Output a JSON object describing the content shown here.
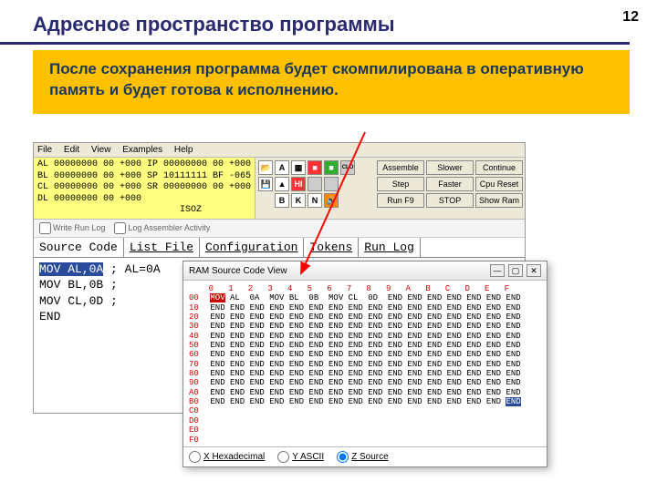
{
  "slide": {
    "title": "Адресное пространство программы",
    "number": "12"
  },
  "callout": "После сохранения программа будет скомпилирована в оперативную память и будет готова к исполнению.",
  "menu": [
    "File",
    "Edit",
    "View",
    "Examples",
    "Help"
  ],
  "registers": [
    "AL 00000000 00 +000 IP 00000000 00 +000",
    "BL 00000000 00 +000 SP 10111111 BF -065",
    "CL 00000000 00 +000 SR 00000000 00 +000",
    "DL 00000000 00 +000",
    "                          ISOZ"
  ],
  "tbIcons": {
    "r0": [
      "📂",
      "A",
      "▦",
      "■",
      "■",
      "CLO"
    ],
    "r1": [
      "💾",
      "▲",
      "HI",
      "■",
      "■",
      ""
    ],
    "r2": [
      "",
      "B",
      "K",
      "N",
      "🔊",
      ""
    ]
  },
  "buttons": {
    "assemble": "Assemble",
    "slower": "Slower",
    "cont": "Continue",
    "step": "Step",
    "faster": "Faster",
    "cpureset": "Cpu Reset",
    "run": "Run F9",
    "stop": "STOP",
    "showram": "Show Ram"
  },
  "logrow": {
    "write": "Write Run Log",
    "logasm": "Log Assembler Activity"
  },
  "tabs": [
    "Source Code",
    "List File",
    "Configuration",
    "Tokens",
    "Run Log"
  ],
  "source": {
    "l0a": "MOV AL,0A",
    "l0b": " ; AL=0A",
    "l1": "MOV BL,0B ;",
    "l2": "MOV CL,0D ;",
    "l3": "END"
  },
  "ram": {
    "title": "RAM Source Code View",
    "header": "    0   1   2   3   4   5   6   7   8   9   A   B   C   D   E   F",
    "rows": [
      {
        "a": "00",
        "c": [
          "MOV",
          "AL",
          "0A",
          "MOV",
          "BL",
          "0B",
          "MOV",
          "CL",
          "0D",
          "END",
          "END",
          "END",
          "END",
          "END",
          "END",
          "END"
        ],
        "hl0": true
      },
      {
        "a": "10",
        "c": [
          "END",
          "END",
          "END",
          "END",
          "END",
          "END",
          "END",
          "END",
          "END",
          "END",
          "END",
          "END",
          "END",
          "END",
          "END",
          "END"
        ]
      },
      {
        "a": "20",
        "c": [
          "END",
          "END",
          "END",
          "END",
          "END",
          "END",
          "END",
          "END",
          "END",
          "END",
          "END",
          "END",
          "END",
          "END",
          "END",
          "END"
        ]
      },
      {
        "a": "30",
        "c": [
          "END",
          "END",
          "END",
          "END",
          "END",
          "END",
          "END",
          "END",
          "END",
          "END",
          "END",
          "END",
          "END",
          "END",
          "END",
          "END"
        ]
      },
      {
        "a": "40",
        "c": [
          "END",
          "END",
          "END",
          "END",
          "END",
          "END",
          "END",
          "END",
          "END",
          "END",
          "END",
          "END",
          "END",
          "END",
          "END",
          "END"
        ]
      },
      {
        "a": "50",
        "c": [
          "END",
          "END",
          "END",
          "END",
          "END",
          "END",
          "END",
          "END",
          "END",
          "END",
          "END",
          "END",
          "END",
          "END",
          "END",
          "END"
        ]
      },
      {
        "a": "60",
        "c": [
          "END",
          "END",
          "END",
          "END",
          "END",
          "END",
          "END",
          "END",
          "END",
          "END",
          "END",
          "END",
          "END",
          "END",
          "END",
          "END"
        ]
      },
      {
        "a": "70",
        "c": [
          "END",
          "END",
          "END",
          "END",
          "END",
          "END",
          "END",
          "END",
          "END",
          "END",
          "END",
          "END",
          "END",
          "END",
          "END",
          "END"
        ]
      },
      {
        "a": "80",
        "c": [
          "END",
          "END",
          "END",
          "END",
          "END",
          "END",
          "END",
          "END",
          "END",
          "END",
          "END",
          "END",
          "END",
          "END",
          "END",
          "END"
        ]
      },
      {
        "a": "90",
        "c": [
          "END",
          "END",
          "END",
          "END",
          "END",
          "END",
          "END",
          "END",
          "END",
          "END",
          "END",
          "END",
          "END",
          "END",
          "END",
          "END"
        ]
      },
      {
        "a": "A0",
        "c": [
          "END",
          "END",
          "END",
          "END",
          "END",
          "END",
          "END",
          "END",
          "END",
          "END",
          "END",
          "END",
          "END",
          "END",
          "END",
          "END"
        ]
      },
      {
        "a": "B0",
        "c": [
          "END",
          "END",
          "END",
          "END",
          "END",
          "END",
          "END",
          "END",
          "END",
          "END",
          "END",
          "END",
          "END",
          "END",
          "END",
          "END"
        ],
        "hlLast": true
      },
      {
        "a": "C0",
        "c": []
      },
      {
        "a": "D0",
        "c": []
      },
      {
        "a": "E0",
        "c": []
      },
      {
        "a": "F0",
        "c": []
      }
    ],
    "footer": {
      "hex": "X Hexadecimal",
      "ascii": "Y ASCII",
      "src": "Z Source"
    }
  }
}
